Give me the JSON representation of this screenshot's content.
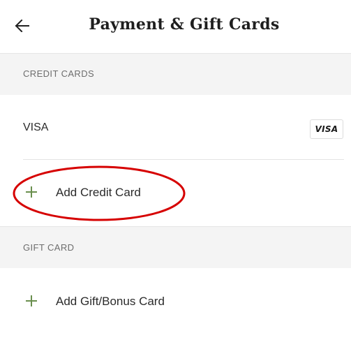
{
  "header": {
    "title": "Payment & Gift Cards",
    "back_icon": "arrow-left-icon"
  },
  "sections": {
    "credit_cards": {
      "header": "CREDIT CARDS",
      "cards": [
        {
          "label": "VISA",
          "badge": "VISA"
        }
      ],
      "add_label": "Add Credit Card",
      "add_icon": "plus-icon"
    },
    "gift_card": {
      "header": "GIFT CARD",
      "add_label": "Add Gift/Bonus Card",
      "add_icon": "plus-icon"
    }
  },
  "annotation": {
    "type": "ellipse",
    "color": "#d60000",
    "target": "Add Credit Card"
  },
  "colors": {
    "accent_green": "#6a8f4e",
    "section_bg": "#f4f4f4",
    "annotation_red": "#d60000"
  }
}
